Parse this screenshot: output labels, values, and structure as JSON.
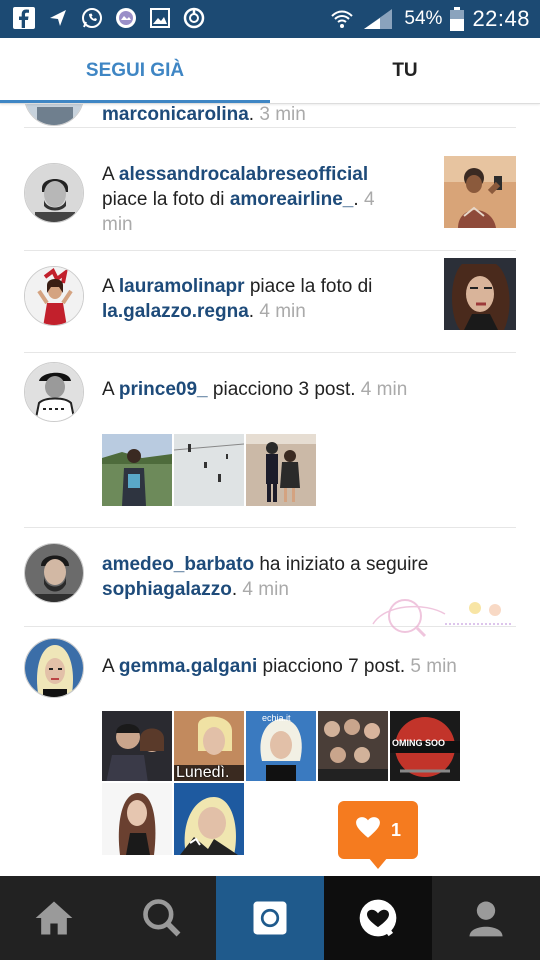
{
  "status_bar": {
    "battery": "54%",
    "time": "22:48",
    "icons": [
      "facebook-icon",
      "send-icon",
      "whatsapp-icon",
      "image-icon",
      "gallery-icon",
      "power-icon",
      "wifi-icon",
      "signal-icon",
      "battery-icon"
    ]
  },
  "tabs": {
    "following": "SEGUI GIÀ",
    "you": "TU"
  },
  "feed": [
    {
      "id": "row0",
      "user": "marconicarolina",
      "suffix": ".",
      "time": "3 min"
    },
    {
      "id": "row1",
      "prefix": "A ",
      "user": "alessandrocalabreseofficial",
      "middle_1": "piace la foto di ",
      "user_2": "amoreairline_",
      "suffix": ". ",
      "time_1": "4",
      "time_2": "min"
    },
    {
      "id": "row2",
      "prefix": "A ",
      "user": "lauramolinapr",
      "middle_1": " piace la foto di",
      "user_2": "la.galazzo.regna",
      "suffix": ". ",
      "time": "4 min"
    },
    {
      "id": "row3",
      "prefix": "A ",
      "user": "prince09_",
      "middle": " piacciono 3 post. ",
      "time": "4 min"
    },
    {
      "id": "row4",
      "user": "amedeo_barbato",
      "middle": " ha iniziato a seguire",
      "user_2": "sophiagalazzo",
      "suffix": ". ",
      "time": "4 min"
    },
    {
      "id": "row5",
      "prefix": "A ",
      "user": "gemma.galgani",
      "middle": " piacciono 7 post. ",
      "time": "5 min",
      "thumb_text_1": "Lunedì.",
      "thumb_text_2": "echia.it",
      "thumb_text_3": "OMING SOO"
    }
  ],
  "notification": {
    "count": "1"
  },
  "bottom_nav": [
    "home-icon",
    "search-icon",
    "camera-icon",
    "activity-icon",
    "profile-icon"
  ]
}
